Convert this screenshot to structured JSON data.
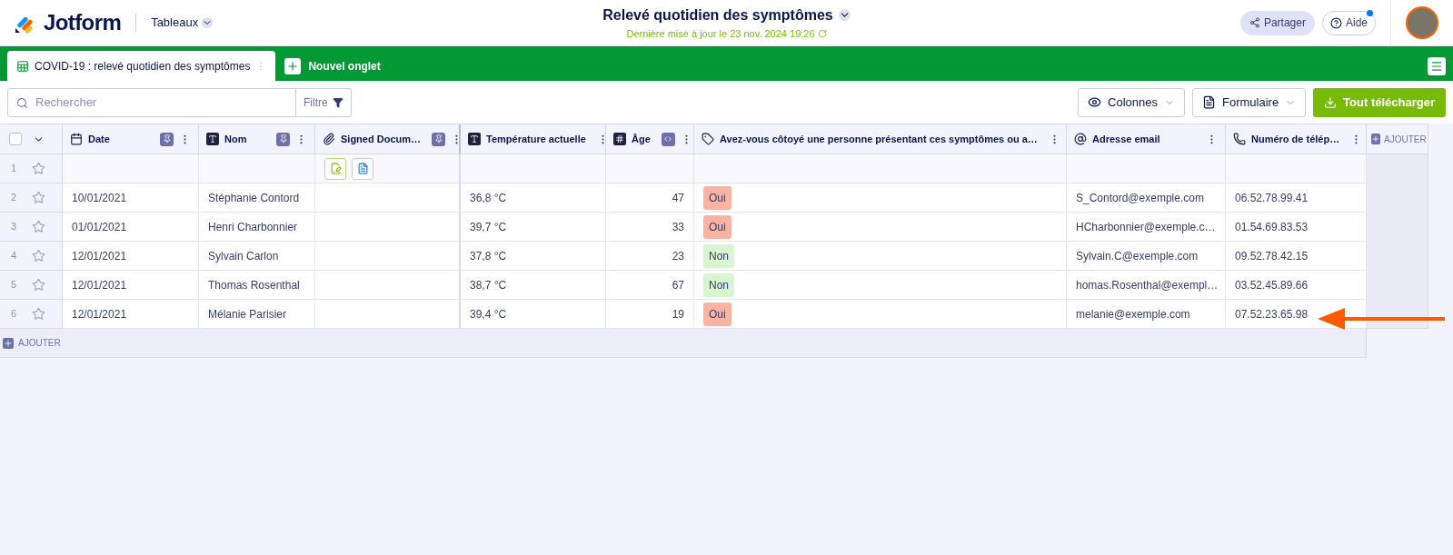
{
  "header": {
    "brand": "Jotform",
    "section": "Tableaux",
    "title": "Relevé quotidien des symptômes",
    "updated": "Dernière mise à jour le 23 nov. 2024 19:26",
    "share": "Partager",
    "help": "Aide",
    "help_notification": true
  },
  "tabs": [
    {
      "label": "COVID-19 : relevé quotidien des symptômes",
      "selected": true
    }
  ],
  "new_tab": "Nouvel onglet",
  "toolbar": {
    "search_placeholder": "Rechercher",
    "filter": "Filtre",
    "columns": "Colonnes",
    "form": "Formulaire",
    "download": "Tout télécharger"
  },
  "table": {
    "all_checked": false,
    "columns": [
      {
        "label": "Date",
        "kind": "date",
        "pinned": true,
        "fit_width": false
      },
      {
        "label": "Nom",
        "kind": "text",
        "pinned": true,
        "fit_width": false
      },
      {
        "label": "Signed Docum…",
        "kind": "file",
        "pinned": true,
        "fit_width": false
      },
      {
        "label": "Température actuelle",
        "kind": "text",
        "pinned": false,
        "fit_width": false
      },
      {
        "label": "Âge",
        "kind": "number",
        "pinned": false,
        "fit_width": true
      },
      {
        "label": "Avez-vous côtoyé une personne présentant ces symptômes ou a…",
        "kind": "tag",
        "pinned": false,
        "fit_width": false
      },
      {
        "label": "Adresse email",
        "kind": "email",
        "pinned": false,
        "fit_width": false
      },
      {
        "label": "Numéro de télép…",
        "kind": "phone",
        "pinned": false,
        "fit_width": false
      }
    ],
    "add_column": "AJOUTER",
    "rows": [
      {
        "number": "1",
        "starred": false,
        "documents": true,
        "date": "",
        "name": "",
        "temperature": "",
        "age": "",
        "answer": null,
        "email": "",
        "phone": ""
      },
      {
        "number": "2",
        "starred": false,
        "documents": false,
        "date": "10/01/2021",
        "name": "Stéphanie Contord",
        "temperature": "36,8 °C",
        "age": "47",
        "answer": {
          "label": "Oui",
          "color": "#f9b3a3"
        },
        "email": "S_Contord@exemple.com",
        "phone": "06.52.78.99.41"
      },
      {
        "number": "3",
        "starred": false,
        "documents": false,
        "date": "01/01/2021",
        "name": "Henri Charbonnier",
        "temperature": "39,7 °C",
        "age": "33",
        "answer": {
          "label": "Oui",
          "color": "#f9b3a3"
        },
        "email": "HCharbonnier@exemple.c…",
        "phone": "01.54.69.83.53"
      },
      {
        "number": "4",
        "starred": false,
        "documents": false,
        "date": "12/01/2021",
        "name": "Sylvain Carlon",
        "temperature": "37,8 °C",
        "age": "23",
        "answer": {
          "label": "Non",
          "color": "#d9f5cf"
        },
        "email": "Sylvain.C@exemple.com",
        "phone": "09.52.78.42.15"
      },
      {
        "number": "5",
        "starred": false,
        "documents": false,
        "date": "12/01/2021",
        "name": "Thomas Rosenthal",
        "temperature": "38,7 °C",
        "age": "67",
        "answer": {
          "label": "Non",
          "color": "#d9f5cf"
        },
        "email": "homas.Rosenthal@exempl…",
        "phone": "03.52.45.89.66"
      },
      {
        "number": "6",
        "starred": false,
        "documents": false,
        "date": "12/01/2021",
        "name": "Mélanie Parisier",
        "temperature": "39,4 °C",
        "age": "19",
        "answer": {
          "label": "Oui",
          "color": "#f9b3a3"
        },
        "email": "melanie@exemple.com",
        "phone": "07.52.23.65.98"
      }
    ],
    "add_row": "AJOUTER"
  }
}
